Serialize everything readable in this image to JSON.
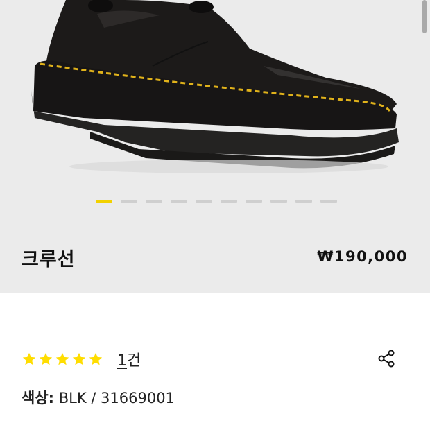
{
  "product": {
    "name": "크루선",
    "price": "₩190,000"
  },
  "carousel": {
    "slide_count": 10,
    "active_index": 0,
    "colors": {
      "active": "#f2d100",
      "inactive": "#cfcfcf"
    }
  },
  "rating": {
    "stars": 5,
    "max": 5,
    "count_number": "1",
    "count_unit": "건",
    "star_color": "#ffdd00"
  },
  "color_info": {
    "label": "색상:",
    "value": " BLK / 31669001"
  },
  "icons": {
    "share": "share-icon",
    "star": "star-icon"
  }
}
